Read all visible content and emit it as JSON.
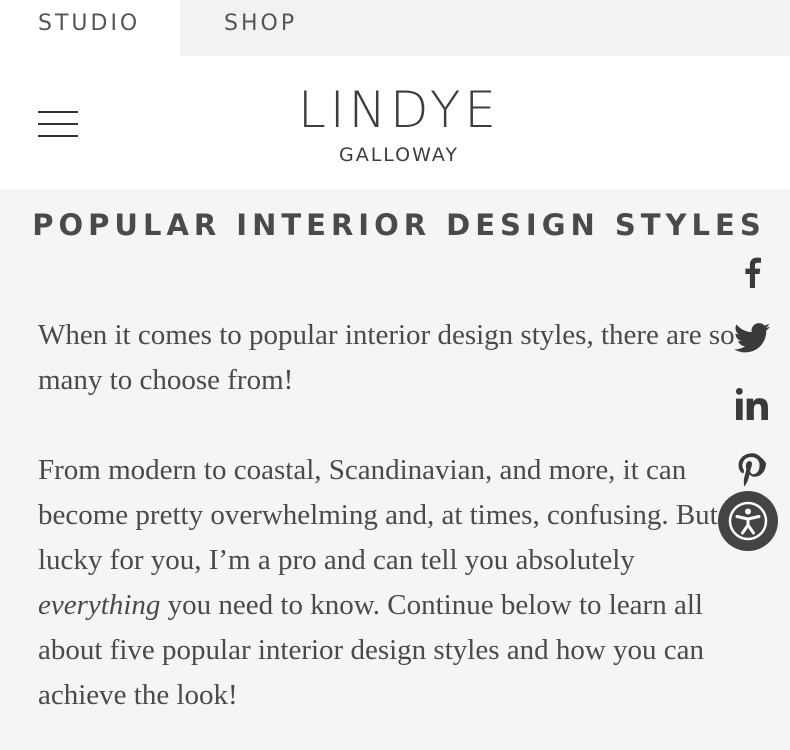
{
  "tabs": [
    {
      "label": "STUDIO"
    },
    {
      "label": "SHOP"
    }
  ],
  "logo": {
    "main": "LINDYE",
    "sub": "GALLOWAY"
  },
  "page": {
    "title": "POPULAR INTERIOR DESIGN STYLES",
    "paragraph1": "When it comes to popular interior design styles, there are so many to choose from!",
    "paragraph2_before": "From modern to coastal, Scandinavian, and more, it can become pretty overwhelming and, at times, confusing. But lucky for you, I’m a pro and can tell you absolutely ",
    "paragraph2_emphasis": "everything",
    "paragraph2_after": " you need to know. Continue below to learn all about five popular interior design styles and how you can achieve the look!"
  },
  "social": [
    "facebook-icon",
    "twitter-icon",
    "linkedin-icon",
    "pinterest-icon"
  ],
  "accessibility": {
    "icon": "accessibility-icon"
  },
  "colors": {
    "background": "#f6f5f3",
    "header": "#ffffff",
    "tab_bar": "#f2f2f1",
    "text": "#4a4a4a",
    "accessibility_button": "#444444"
  }
}
